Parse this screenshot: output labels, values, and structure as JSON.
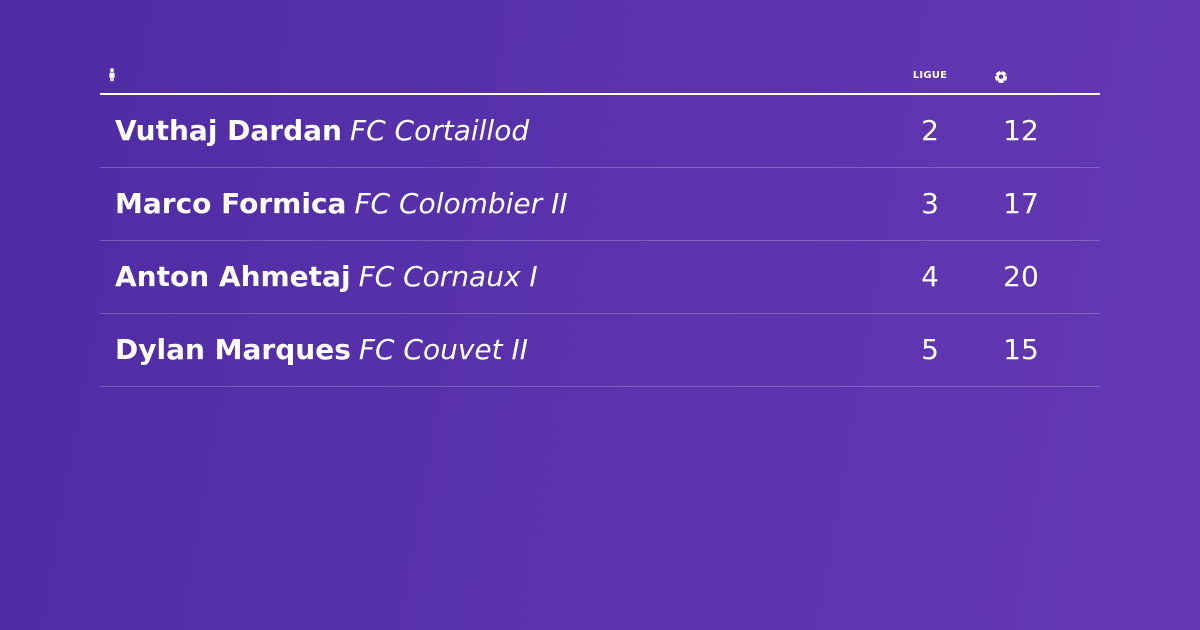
{
  "header": {
    "player_icon": "person-icon",
    "league_label": "LIGUE",
    "goals_icon": "soccer-ball-icon"
  },
  "rows": [
    {
      "player": "Vuthaj Dardan",
      "club": "FC Cortaillod",
      "league": "2",
      "goals": "12"
    },
    {
      "player": "Marco Formica",
      "club": "FC Colombier II",
      "league": "3",
      "goals": "17"
    },
    {
      "player": "Anton Ahmetaj",
      "club": "FC Cornaux I",
      "league": "4",
      "goals": "20"
    },
    {
      "player": "Dylan Marques",
      "club": "FC Couvet II",
      "league": "5",
      "goals": "15"
    }
  ],
  "colors": {
    "background_start": "#4e2ba3",
    "background_end": "#6538b4",
    "text": "#ffffff"
  }
}
